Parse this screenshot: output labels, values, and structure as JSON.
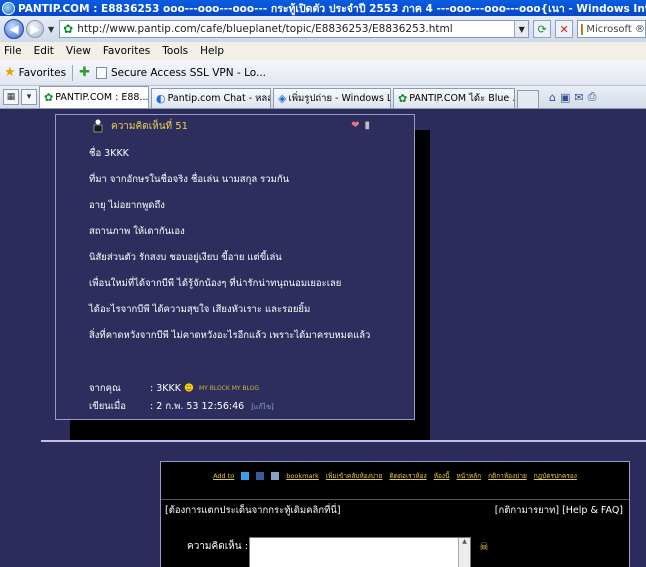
{
  "window": {
    "title": "PANTIP.COM : E8836253 ooo---ooo---ooo--- กระทู้เปิดตัว ประจำปี 2553 ภาค 4 ---ooo---ooo---ooo{เนา - Windows Internet Explorer"
  },
  "address": {
    "url": "http://www.pantip.com/cafe/blueplanet/topic/E8836253/E8836253.html",
    "search_placeholder": "Microsoft ®"
  },
  "menu": [
    "File",
    "Edit",
    "View",
    "Favorites",
    "Tools",
    "Help"
  ],
  "favorites": {
    "label": "Favorites",
    "items": [
      "Secure Access SSL VPN - Lo..."
    ]
  },
  "tabs": [
    {
      "label": "PANTIP.COM : E88...",
      "active": true
    },
    {
      "label": "Pantip.com Chat - หลส...",
      "active": false
    },
    {
      "label": "เพิ่มรูปถ่าย - Windows Live",
      "active": false
    },
    {
      "label": "PANTIP.COM ได้ะ Blue ...",
      "active": false
    }
  ],
  "reply": {
    "header": "ความคิดเห็นที่ 51",
    "lines": [
      "ชื่อ 3KKK",
      "ที่มา    จากอักษรในชื่อจริง ชื่อเล่น นามสกุล รวมกัน",
      "อายุ   ไม่อยากพูดถึง",
      "สถานภาพ   ให้เดากันเอง",
      "นิสัยส่วนตัว    รักสงบ ชอบอยู่เงียบ ขี้อาย แต่ขี้เล่น",
      "เพื่อนใหม่ที่ได้จากบีพี    ได้รู้จักน้องๆ ที่น่ารักน่าทนุถนอมเยอะเลย",
      "ได้อะไรจากบีพี   ได้ความสุขใจ เสียงหัวเราะ และรอยยิ้ม",
      "สิ่งที่คาดหวังจากบีพี    ไม่คาดหวังอะไรอีกแล้ว เพราะได้มาครบหมดแล้ว"
    ],
    "from_label": "จากคุณ",
    "from_value": ": 3KKK",
    "blog_text": "MY BLOCK MY BLOG",
    "date_label": "เขียนเมื่อ",
    "date_value": ": 2 ก.พ. 53 12:56:46",
    "edited": "[แก้ไข]"
  },
  "form": {
    "links": [
      "Add to",
      "bookmark",
      "เพิ่มเข้าคลับห้องบ่าย",
      "ติดต่อเราห้อง",
      "ห้องนี้",
      "หน้าหลัก",
      "กติกาห้องบ่าย",
      "กฎบัตรปกครอง"
    ],
    "report_link": "[ต้องการแตกประเด็นจากกระทู้เดิมคลิกที่นี่]",
    "rules_link": "[กติกามารยาท]",
    "help_link": "[Help & FAQ]",
    "comment_label": "ความคิดเห็น :"
  }
}
